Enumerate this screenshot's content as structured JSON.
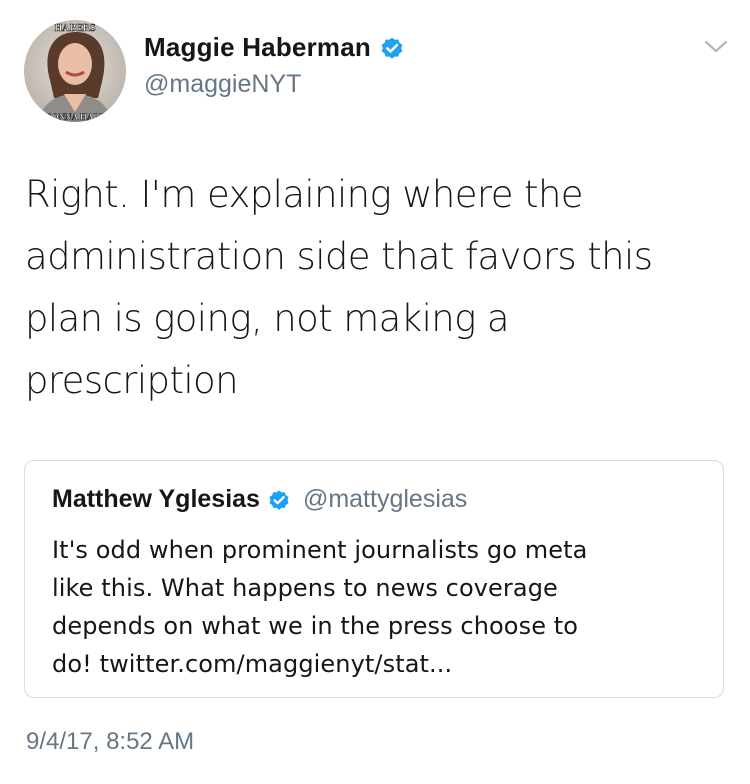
{
  "tweet": {
    "author": {
      "display_name": "Maggie Haberman",
      "handle": "@maggieNYT",
      "verified": true,
      "avatar_icon": "avatar-photo",
      "avatar_text_top": "HABERS",
      "avatar_text_bottom": "GONNA HABE"
    },
    "menu_icon": "chevron-down-icon",
    "text_lines": [
      "Right. I'm explaining where the",
      "administration side that favors this",
      "plan is going, not making a",
      "prescription"
    ],
    "quoted": {
      "display_name": "Matthew Yglesias",
      "handle": "@mattyglesias",
      "verified": true,
      "text_lines": [
        "It's odd when prominent journalists go meta",
        "like this. What happens to news coverage",
        "depends on what we in the press choose to",
        "do! twitter.com/maggienyt/stat..."
      ]
    },
    "timestamp": "9/4/17, 8:52 AM"
  },
  "colors": {
    "verified_blue": "#1da1f2",
    "text_primary": "#14171a",
    "text_secondary": "#657786",
    "border": "#d6dce1"
  }
}
